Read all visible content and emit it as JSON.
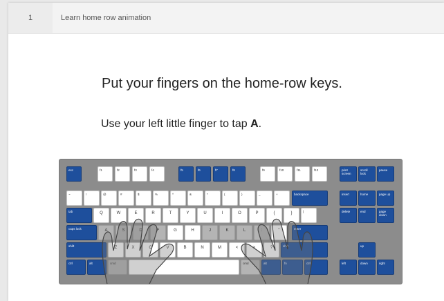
{
  "header": {
    "step_number": "1",
    "title": "Learn home row animation"
  },
  "lesson": {
    "heading": "Put your fingers on the home-row keys.",
    "instruction_prefix": "Use your left little finger to tap ",
    "instruction_key": "A",
    "instruction_suffix": "."
  },
  "keyboard": {
    "row_fn": [
      "esc",
      "f1",
      "f2",
      "f3",
      "f4",
      "f5",
      "f6",
      "f7",
      "f8",
      "f9",
      "f10",
      "f11",
      "f12"
    ],
    "row_fn_right": [
      "print screen",
      "scroll lock",
      "pause"
    ],
    "row_num": [
      "~",
      "!",
      "@",
      "#",
      "$",
      "%",
      "^",
      "&",
      "*",
      "(",
      ")",
      "_",
      "+",
      "backspace"
    ],
    "row_nav1": [
      "insert",
      "home",
      "page up"
    ],
    "row_top": [
      "tab",
      "Q",
      "W",
      "E",
      "R",
      "T",
      "Y",
      "U",
      "I",
      "O",
      "P",
      "{",
      "}",
      "|"
    ],
    "row_nav2": [
      "delete",
      "end",
      "page down"
    ],
    "row_home": [
      "caps lock",
      "A",
      "S",
      "D",
      "F",
      "G",
      "H",
      "J",
      "K",
      "L",
      ":",
      "\"",
      "enter"
    ],
    "row_bottom": [
      "shift",
      "Z",
      "X",
      "C",
      "V",
      "B",
      "N",
      "M",
      "<",
      ">",
      "?",
      "shift"
    ],
    "row_space": [
      "ctrl",
      "alt",
      "cmd",
      "",
      "cmd",
      "alt",
      "fn",
      "ctrl"
    ],
    "arrow_up": "up",
    "arrows": [
      "left",
      "down",
      "right"
    ],
    "highlight_color": "#1e4f9c"
  }
}
